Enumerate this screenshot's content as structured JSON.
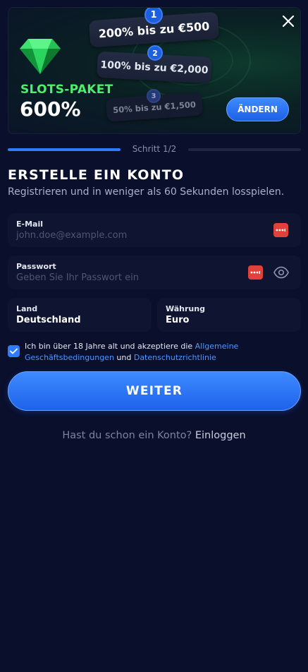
{
  "banner": {
    "package_label": "SLOTS-PAKET",
    "package_percent": "600%",
    "tiers": [
      {
        "number": "1",
        "text": "200% bis zu €500"
      },
      {
        "number": "2",
        "text": "100% bis zu €2,000"
      },
      {
        "number": "3",
        "text": "50% bis zu €1,500"
      }
    ],
    "change_button": "ÄNDERN",
    "close_icon": "close-icon",
    "gem_icon": "emerald-gem-icon"
  },
  "progress": {
    "label": "Schritt 1/2",
    "current_step": 1,
    "total_steps": 2
  },
  "header": {
    "title": "ERSTELLE EIN KONTO",
    "subtitle": "Registrieren und in weniger als 60 Sekunden losspielen."
  },
  "form": {
    "email": {
      "label": "E-Mail",
      "placeholder": "john.doe@example.com"
    },
    "password": {
      "label": "Passwort",
      "placeholder": "Geben Sie Ihr Passwort ein"
    },
    "country": {
      "label": "Land",
      "value": "Deutschland"
    },
    "currency": {
      "label": "Währung",
      "value": "Euro"
    },
    "terms": {
      "checked": true,
      "text_before": "Ich bin über 18 Jahre alt und akzeptiere die ",
      "terms_link": "Allgemeine Geschäftsbedingungen",
      "text_middle": " und ",
      "privacy_link": "Datenschutzrichtlinie"
    },
    "submit_label": "WEITER"
  },
  "footer": {
    "question": "Hast du schon ein Konto?",
    "login_link": "Einloggen"
  },
  "colors": {
    "background": "#0a0f2c",
    "accent": "#2f7dff",
    "slots_green": "#4cf06a",
    "password_manager_red": "#e0413b"
  }
}
